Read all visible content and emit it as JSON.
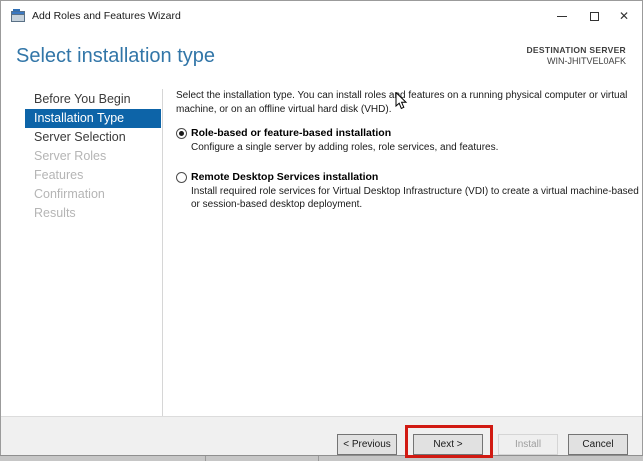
{
  "window": {
    "title": "Add Roles and Features Wizard"
  },
  "titlebar": {
    "close_icon": "✕"
  },
  "header": {
    "title": "Select installation type",
    "destination_label": "DESTINATION SERVER",
    "destination_server": "WIN-JHITVEL0AFK"
  },
  "sidebar": {
    "items": [
      {
        "label": "Before You Begin",
        "state": "enabled"
      },
      {
        "label": "Installation Type",
        "state": "active"
      },
      {
        "label": "Server Selection",
        "state": "enabled"
      },
      {
        "label": "Server Roles",
        "state": "disabled"
      },
      {
        "label": "Features",
        "state": "disabled"
      },
      {
        "label": "Confirmation",
        "state": "disabled"
      },
      {
        "label": "Results",
        "state": "disabled"
      }
    ]
  },
  "content": {
    "intro_lines": [
      "Select the installation type. You can install roles and features on a running physical computer or virtual",
      "machine, or on an offline virtual hard disk (VHD)."
    ],
    "options": [
      {
        "label": "Role-based or feature-based installation",
        "selected": true,
        "description_lines": [
          "Configure a single server by adding roles, role services, and features."
        ]
      },
      {
        "label": "Remote Desktop Services installation",
        "selected": false,
        "description_lines": [
          "Install required role services for Virtual Desktop Infrastructure (VDI) to create a virtual machine-based",
          "or session-based desktop deployment."
        ]
      }
    ]
  },
  "footer": {
    "buttons": [
      {
        "label": "< Previous",
        "enabled": true
      },
      {
        "label": "Next >",
        "enabled": true
      },
      {
        "label": "Install",
        "enabled": false
      },
      {
        "label": "Cancel",
        "enabled": true
      }
    ]
  },
  "annotation": {
    "highlight_target": "Next >"
  },
  "colors": {
    "accent_blue": "#0d64a8",
    "heading_blue": "#3276a8",
    "annotation_red": "#d11a12",
    "disabled_text": "#b5b5b5"
  }
}
